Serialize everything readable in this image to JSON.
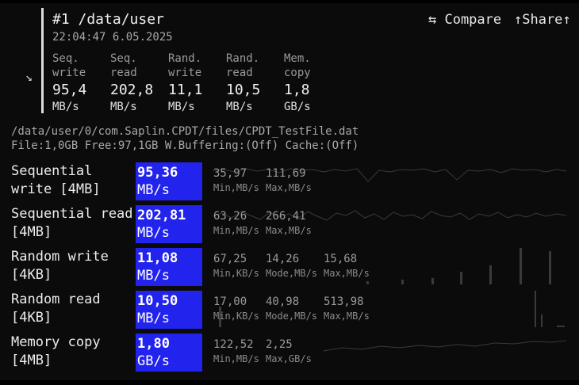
{
  "header": {
    "title": "#1 /data/user",
    "datetime": "22:04:47 6.05.2025",
    "compare_label": "⇆ Compare",
    "share_label": "↑Share↑",
    "expand_icon": "↘"
  },
  "summary": [
    {
      "l1": "Seq.",
      "l2": "write",
      "value": "95,4",
      "unit": "MB/s"
    },
    {
      "l1": "Seq.",
      "l2": "read",
      "value": "202,8",
      "unit": "MB/s"
    },
    {
      "l1": "Rand.",
      "l2": "write",
      "value": "11,1",
      "unit": "MB/s"
    },
    {
      "l1": "Rand.",
      "l2": "read",
      "value": "10,5",
      "unit": "MB/s"
    },
    {
      "l1": "Mem.",
      "l2": "copy",
      "value": "1,8",
      "unit": "GB/s"
    }
  ],
  "file": {
    "path": "/data/user/0/com.Saplin.CPDT/files/CPDT_TestFile.dat",
    "info": "File:1,0GB Free:97,1GB W.Buffering:(Off) Cache:(Off)"
  },
  "results": [
    {
      "label1": "Sequential",
      "label2": "write [4MB]",
      "value": "95,36",
      "unit": "MB/s",
      "stats": [
        {
          "v": "35,97",
          "l": "Min,MB/s"
        },
        {
          "v": "111,69",
          "l": "Max,MB/s"
        }
      ]
    },
    {
      "label1": "Sequential read",
      "label2": "[4MB]",
      "value": "202,81",
      "unit": "MB/s",
      "stats": [
        {
          "v": "63,26",
          "l": "Min,MB/s"
        },
        {
          "v": "266,41",
          "l": "Max,MB/s"
        }
      ]
    },
    {
      "label1": "Random write",
      "label2": "[4KB]",
      "value": "11,08",
      "unit": "MB/s",
      "stats": [
        {
          "v": "67,25",
          "l": "Min,KB/s"
        },
        {
          "v": "14,26",
          "l": "Mode,MB/s"
        },
        {
          "v": "15,68",
          "l": "Max,MB/s"
        }
      ]
    },
    {
      "label1": "Random read",
      "label2": "[4KB]",
      "value": "10,50",
      "unit": "MB/s",
      "stats": [
        {
          "v": "17,00",
          "l": "Min,KB/s"
        },
        {
          "v": "40,98",
          "l": "Mode,MB/s"
        },
        {
          "v": "513,98",
          "l": "Max,MB/s"
        }
      ]
    },
    {
      "label1": "Memory copy",
      "label2": "[4MB]",
      "value": "1,80",
      "unit": "GB/s",
      "stats": [
        {
          "v": "122,52",
          "l": "Min,MB/s"
        },
        {
          "v": "2,25",
          "l": "Max,GB/s"
        }
      ]
    }
  ],
  "colors": {
    "accent": "#2323ee",
    "background": "#0b0b0b",
    "sparkline": "#3a3a3a"
  }
}
